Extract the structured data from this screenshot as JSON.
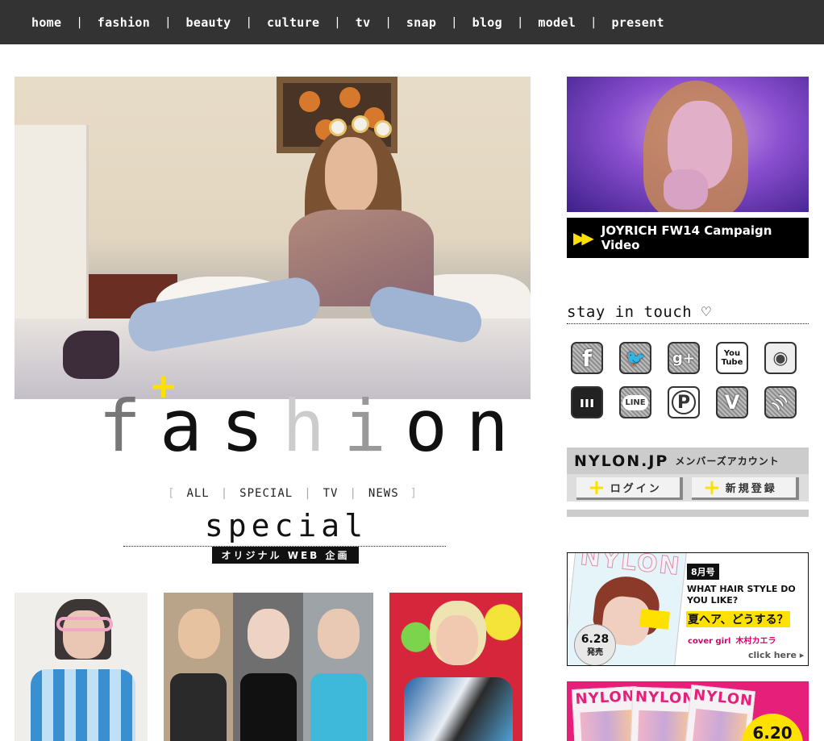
{
  "nav": {
    "items": [
      "home",
      "fashion",
      "beauty",
      "culture",
      "tv",
      "snap",
      "blog",
      "model",
      "present"
    ],
    "separator": "|"
  },
  "hero": {
    "plus_symbol": "+"
  },
  "section": {
    "title_letters": [
      "f",
      "a",
      "s",
      "h",
      "i",
      "o",
      "n"
    ],
    "subnav": {
      "bracket_left": "[",
      "bracket_right": "]",
      "items": [
        "ALL",
        "SPECIAL",
        "TV",
        "NEWS"
      ],
      "separator": "|"
    },
    "heading": "special",
    "heading_tag": "オリジナル WEB 企画"
  },
  "sidebar": {
    "promo": {
      "icon": "fast-forward-icon",
      "label": "JOYRICH FW14 Campaign Video",
      "accent_color": "#ffe100"
    },
    "stay_in_touch": "stay in touch ♡",
    "social": [
      {
        "name": "facebook-icon",
        "glyph": "f"
      },
      {
        "name": "twitter-icon",
        "glyph": "🐦"
      },
      {
        "name": "google-plus-icon",
        "glyph": "g+"
      },
      {
        "name": "youtube-icon",
        "glyph": "You Tube"
      },
      {
        "name": "instagram-icon",
        "glyph": "◉"
      },
      {
        "name": "mixi-icon",
        "glyph": "ııı"
      },
      {
        "name": "line-icon",
        "glyph": "LINE"
      },
      {
        "name": "pinterest-icon",
        "glyph": "P"
      },
      {
        "name": "vine-icon",
        "glyph": "V"
      },
      {
        "name": "rss-icon",
        "glyph": ")))"
      }
    ],
    "member": {
      "logo": "NYLON.JP",
      "account_label": "メンバーズアカウント",
      "login": "ログイン",
      "register": "新規登録",
      "plus": "+"
    },
    "magazine": {
      "cover_logo": "NYLON",
      "release_date": "6.28",
      "release_label": "発売",
      "issue": "8月号",
      "question": "WHAT HAIR STYLE DO YOU LIKE?",
      "headline": "夏ヘア、どうする？",
      "cover_girl_label": "cover girl",
      "cover_girl_name": "木村カエラ",
      "click_here": "click here ▸"
    },
    "magazine2": {
      "cover_logo": "NYLON",
      "release_date": "6.20"
    }
  },
  "colors": {
    "nav_bg": "#333333",
    "accent_yellow": "#ffe100",
    "black": "#000000"
  }
}
